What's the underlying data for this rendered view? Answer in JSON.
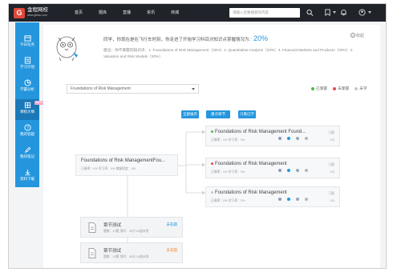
{
  "brand": {
    "name": "金程网校",
    "sub": "www.gfedu.com",
    "mark": "G"
  },
  "nav": [
    "首页",
    "题库",
    "直播",
    "资讯",
    "商城"
  ],
  "search": {
    "placeholder": "请输入您要搜索的内容"
  },
  "sidebar": [
    {
      "label": "今日任务",
      "icon": "calendar-icon"
    },
    {
      "label": "学习计划",
      "icon": "plan-icon"
    },
    {
      "label": "学霸分析",
      "icon": "chart-icon"
    },
    {
      "label": "课程大纲",
      "icon": "outline-icon",
      "badge": "NEW",
      "active": true
    },
    {
      "label": "我的答疑",
      "icon": "question-icon"
    },
    {
      "label": "我的笔记",
      "icon": "pen-icon"
    },
    {
      "label": "资料下载",
      "icon": "download-icon"
    }
  ],
  "banner": {
    "greeting": "同学，你现在是在飞行车时刻，你走进了开始学习科目对知识点掌握情况为：",
    "percent": "20%",
    "note": "建议：你不掌握的知识点：1. Foundations of Risk Management（30%）2. Quantitative Analysis（20%）3. Financial Markets and Products（30%）4. Valuation and Risk Models（20%）",
    "collapse": "收起"
  },
  "course_select": {
    "value": "Foundations of Risk Management"
  },
  "legend": [
    {
      "label": "已掌握",
      "color": "#52b947"
    },
    {
      "label": "未掌握",
      "color": "#e94b4b"
    },
    {
      "label": "未学",
      "color": "#c8c8c8"
    }
  ],
  "buttons": [
    "全部展开",
    "重点章节",
    "只看已学"
  ],
  "root_node": {
    "title": "Foundations of Risk ManagementFou...",
    "meta": "正确率：0%   学习率：0%   掌握程度：4/8"
  },
  "child_nodes": [
    {
      "title": "Foundations of Risk Management Found...",
      "meta": "正确率：0%   学习率：0%",
      "status": "#52b947",
      "r1": "习题",
      "r2": "0/5"
    },
    {
      "title": "Foundations of Risk Management",
      "meta": "正确率：0%   学习率：0%",
      "status": "#e94b4b",
      "r1": "习题",
      "r2": "0/5"
    },
    {
      "title": "Foundations of Risk Management",
      "meta": "正确率：0%   学习率：0%",
      "status": "#c8c8c8",
      "r1": "习题",
      "r2": "0/5"
    }
  ],
  "quizzes": [
    {
      "title": "章节测试",
      "meta": "题数：10题   用时：30分   10道未答",
      "status": "未答题",
      "status_color": "#2596dd"
    },
    {
      "title": "章节测试",
      "meta": "题数：10题   用时：30分   10道未答",
      "status": "未答题",
      "status_color": "#f0883b"
    }
  ]
}
